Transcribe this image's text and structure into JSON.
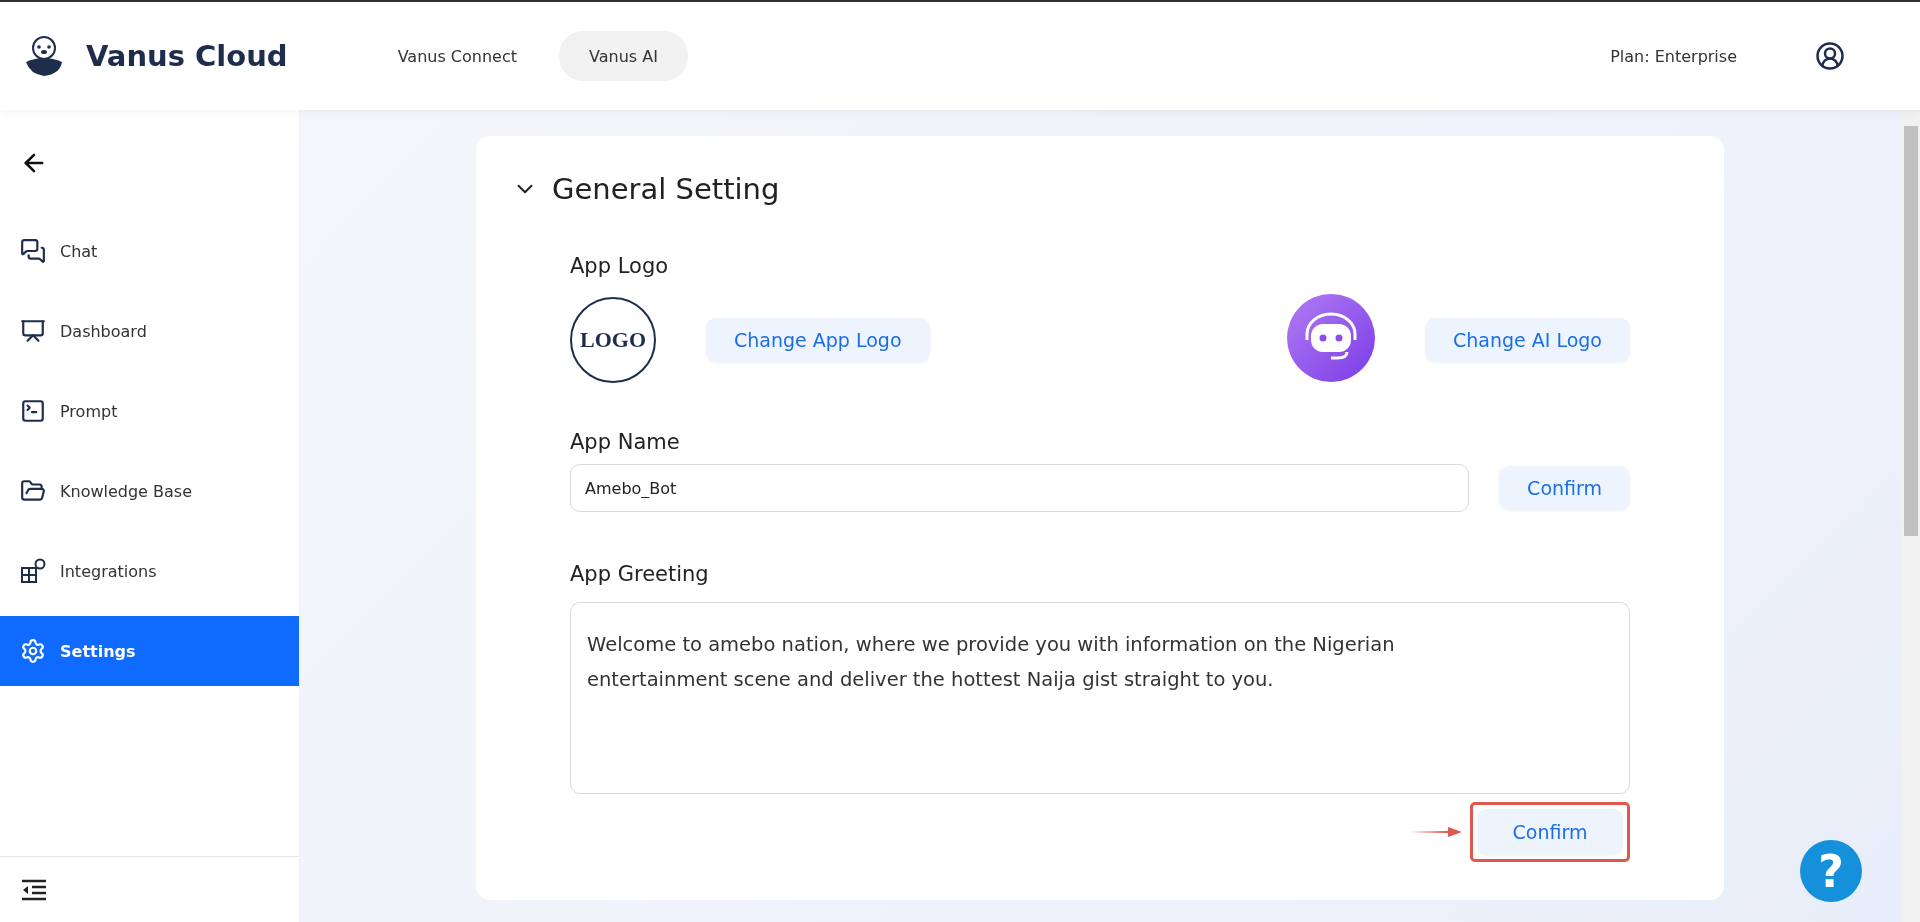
{
  "header": {
    "brand": "Vanus Cloud",
    "tabs": [
      {
        "label": "Vanus Connect",
        "selected": false
      },
      {
        "label": "Vanus AI",
        "selected": true
      }
    ],
    "plan": "Plan: Enterprise"
  },
  "sidebar": {
    "items": [
      {
        "label": "Chat",
        "kind": "chat",
        "selected": false
      },
      {
        "label": "Dashboard",
        "kind": "dashboard",
        "selected": false
      },
      {
        "label": "Prompt",
        "kind": "prompt",
        "selected": false
      },
      {
        "label": "Knowledge Base",
        "kind": "knowledge",
        "selected": false
      },
      {
        "label": "Integrations",
        "kind": "integrations",
        "selected": false
      },
      {
        "label": "Settings",
        "kind": "settings",
        "selected": true
      }
    ]
  },
  "section": {
    "title": "General Setting",
    "expanded": true,
    "logo": {
      "label": "App Logo",
      "app_logo_text": "LOGO",
      "app_button": "Change App Logo",
      "ai_button": "Change AI Logo"
    },
    "name": {
      "label": "App Name",
      "value": "Amebo_Bot",
      "button": "Confirm"
    },
    "greeting": {
      "label": "App Greeting",
      "value": "Welcome to amebo nation, where we provide you with information on the Nigerian entertainment scene and deliver the hottest Naija gist straight to you.",
      "button": "Confirm",
      "highlighted": true
    }
  },
  "help": {
    "label": "?"
  }
}
